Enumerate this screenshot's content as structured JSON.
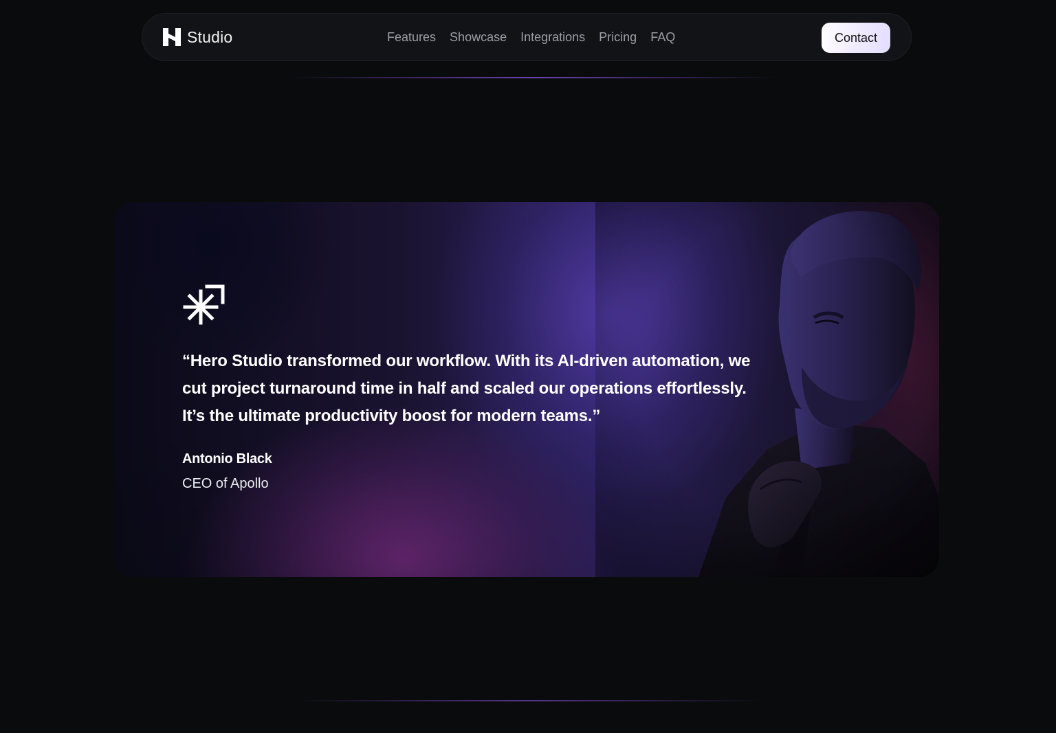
{
  "nav": {
    "brand_name": "Studio",
    "links": [
      "Features",
      "Showcase",
      "Integrations",
      "Pricing",
      "FAQ"
    ],
    "contact_label": "Contact"
  },
  "testimonial": {
    "quote": "“Hero Studio transformed our workflow. With its AI-driven automation, we cut project turnaround time in half and scaled our operations effortlessly. It’s the ultimate productivity boost for modern teams.”",
    "author_name": "Antonio Black",
    "author_role": "CEO of Apollo"
  },
  "icons": {
    "brand_logo": "h-logo-icon",
    "quote_mark": "asterisk-corner-icon"
  },
  "colors": {
    "page_bg": "#0a0b0d",
    "nav_bg": "#121316",
    "nav_link": "#9c9ea4",
    "accent_purple": "#7e4cd2",
    "card_magenta": "#782c82",
    "card_violet": "#5a40b4",
    "contact_btn_bg": "#f1ebff"
  }
}
